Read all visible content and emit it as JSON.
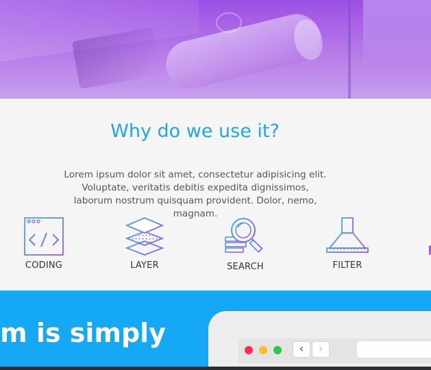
{
  "features_section": {
    "title": "Why do we use it?",
    "description": "Lorem ipsum dolor sit amet, consectetur adipisicing elit. Voluptate, veritatis debitis expedita dignissimos, laborum nostrum quisquam provident. Dolor, nemo, magnam.",
    "items": [
      {
        "label": "CODING",
        "icon": "code-window-icon"
      },
      {
        "label": "LAYER",
        "icon": "layers-icon"
      },
      {
        "label": "SEARCH",
        "icon": "magnifier-icon"
      },
      {
        "label": "FILTER",
        "icon": "filter-flask-icon"
      }
    ]
  },
  "banner": {
    "headline": "m is simply"
  },
  "colors": {
    "hero_purple": "#9c4fe6",
    "title_blue": "#1ea7ec",
    "banner_blue": "#14a8f5",
    "icon_gradient_start": "#3ab0f0",
    "icon_gradient_end": "#9b59e6",
    "dot_red": "#fc2d55",
    "dot_yellow": "#fdbc2e",
    "dot_green": "#29c940"
  }
}
